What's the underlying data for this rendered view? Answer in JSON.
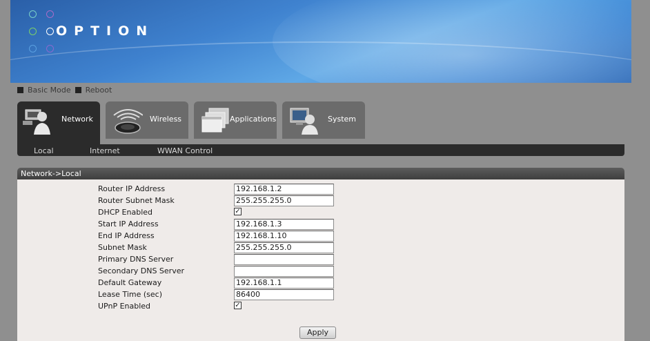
{
  "brand": {
    "logo_text": "OPTION",
    "dot_colors": [
      "#7ad0c8",
      "#a86cc8",
      "#7bd06a",
      "#ffffff",
      "#5aa0e0",
      "#8a6ad0"
    ]
  },
  "mode_links": [
    "Basic Mode",
    "Reboot"
  ],
  "tabs": [
    {
      "label": "Network",
      "icon": "network-user-icon",
      "active": true
    },
    {
      "label": "Wireless",
      "icon": "wireless-icon",
      "active": false
    },
    {
      "label": "Applications",
      "icon": "applications-icon",
      "active": false
    },
    {
      "label": "System",
      "icon": "system-icon",
      "active": false
    }
  ],
  "subnav": [
    "Local",
    "Internet",
    "WWAN Control"
  ],
  "panel": {
    "title": "Network->Local",
    "fields": [
      {
        "label": "Router IP Address",
        "type": "text",
        "value": "192.168.1.2"
      },
      {
        "label": "Router Subnet Mask",
        "type": "text",
        "value": "255.255.255.0"
      },
      {
        "label": "DHCP Enabled",
        "type": "checkbox",
        "checked": true
      },
      {
        "label": "Start IP Address",
        "type": "text",
        "value": "192.168.1.3"
      },
      {
        "label": "End IP Address",
        "type": "text",
        "value": "192.168.1.10"
      },
      {
        "label": "Subnet Mask",
        "type": "text",
        "value": "255.255.255.0"
      },
      {
        "label": "Primary DNS Server",
        "type": "text",
        "value": ""
      },
      {
        "label": "Secondary DNS Server",
        "type": "text",
        "value": ""
      },
      {
        "label": "Default Gateway",
        "type": "text",
        "value": "192.168.1.1"
      },
      {
        "label": "Lease Time (sec)",
        "type": "text",
        "value": "86400"
      },
      {
        "label": "UPnP Enabled",
        "type": "checkbox",
        "checked": true
      }
    ],
    "apply_label": "Apply"
  }
}
